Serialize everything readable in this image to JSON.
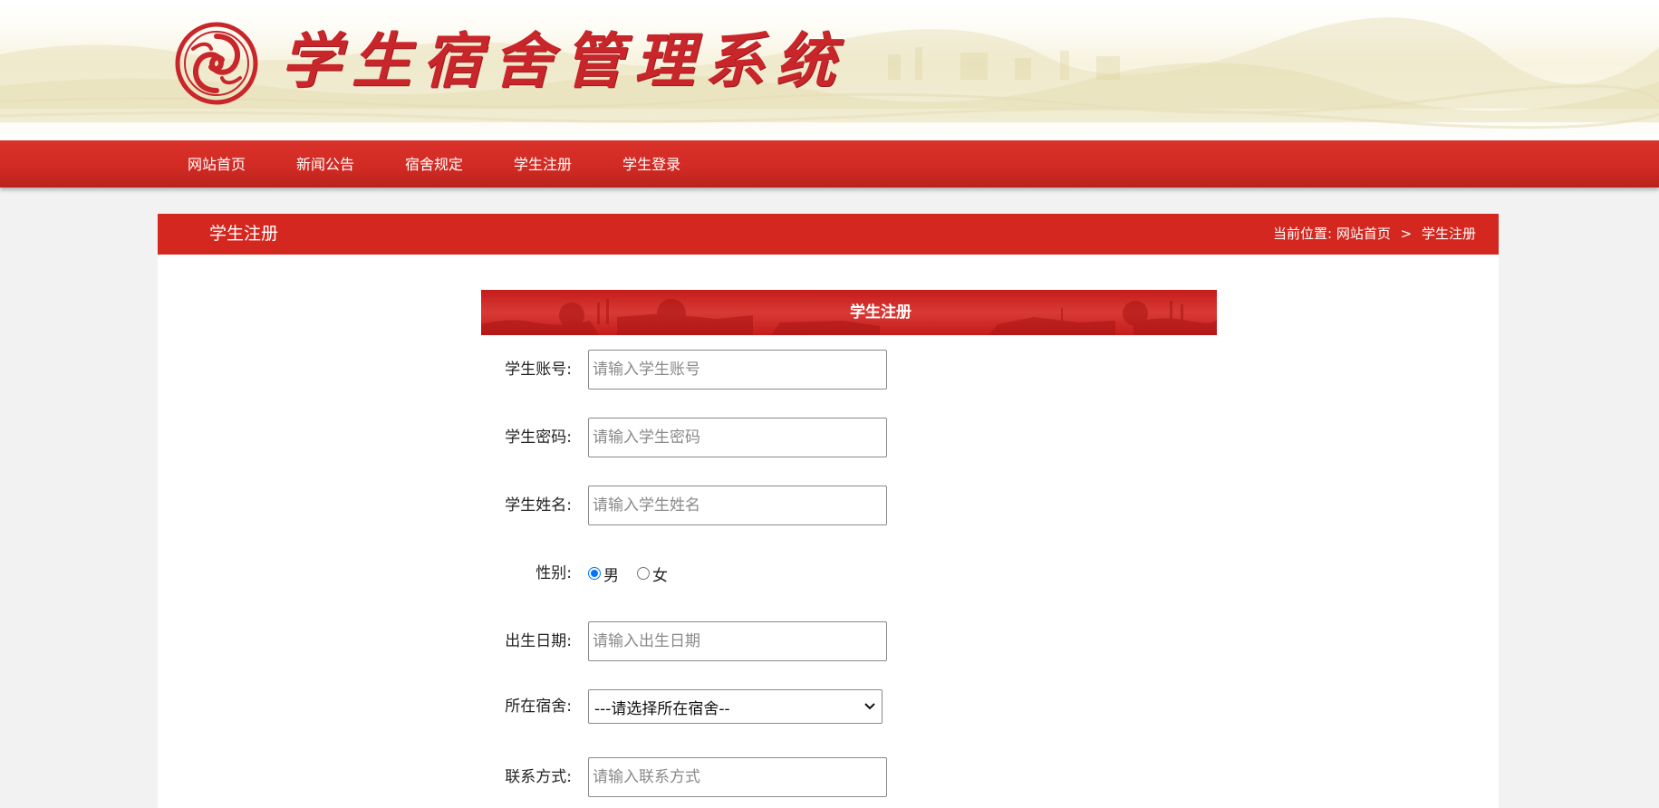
{
  "header": {
    "site_title": "学生宿舍管理系统"
  },
  "nav": {
    "items": [
      {
        "label": "网站首页"
      },
      {
        "label": "新闻公告"
      },
      {
        "label": "宿舍规定"
      },
      {
        "label": "学生注册"
      },
      {
        "label": "学生登录"
      }
    ]
  },
  "panel": {
    "title": "学生注册",
    "breadcrumb": {
      "prefix": "当前位置:",
      "home": "网站首页",
      "separator": ">",
      "current": "学生注册"
    }
  },
  "form": {
    "title": "学生注册",
    "account": {
      "label": "学生账号:",
      "placeholder": "请输入学生账号",
      "value": ""
    },
    "password": {
      "label": "学生密码:",
      "placeholder": "请输入学生密码",
      "value": ""
    },
    "name": {
      "label": "学生姓名:",
      "placeholder": "请输入学生姓名",
      "value": ""
    },
    "gender": {
      "label": "性别:",
      "options": [
        {
          "label": "男",
          "checked": true
        },
        {
          "label": "女",
          "checked": false
        }
      ]
    },
    "birthday": {
      "label": "出生日期:",
      "placeholder": "请输入出生日期",
      "value": ""
    },
    "dorm": {
      "label": "所在宿舍:",
      "selected": "---请选择所在宿舍--"
    },
    "contact": {
      "label": "联系方式:",
      "placeholder": "请输入联系方式",
      "value": ""
    }
  },
  "colors": {
    "brand_red": "#d3271f",
    "page_bg": "#f2f2f2",
    "radio_accent": "#0075ff"
  }
}
